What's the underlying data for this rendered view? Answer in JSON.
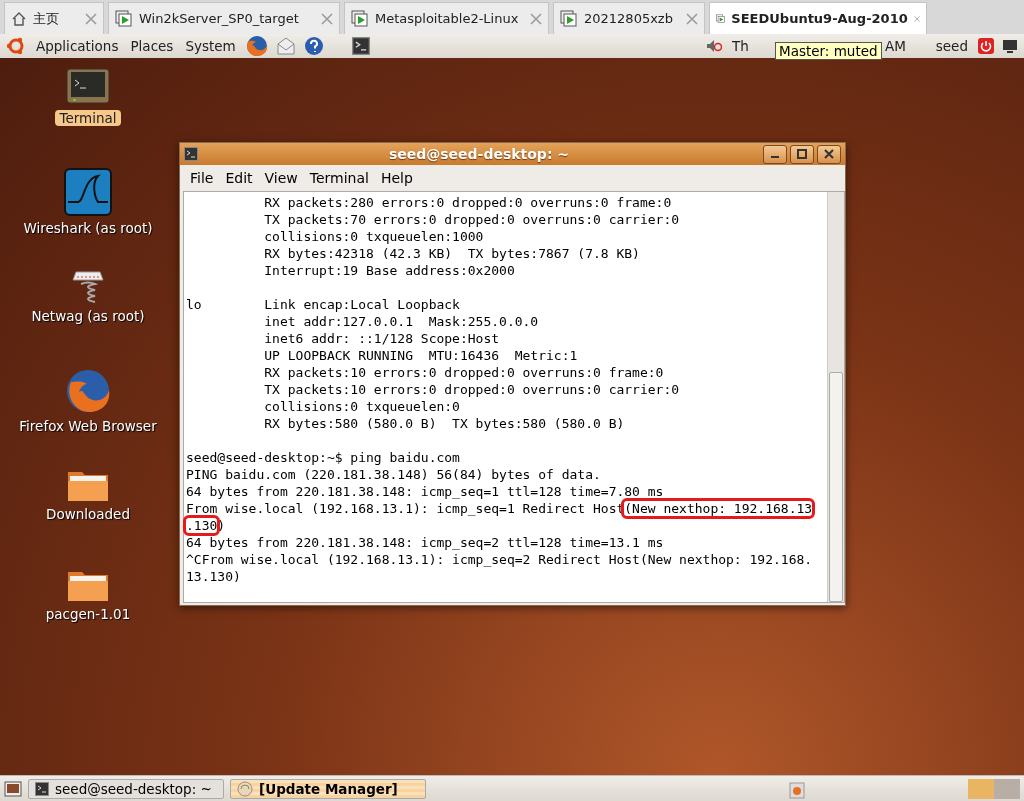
{
  "tabs": [
    {
      "label": "主页",
      "kind": "home",
      "selected": false
    },
    {
      "label": "Win2kServer_SP0_target",
      "kind": "vm",
      "selected": false
    },
    {
      "label": "Metasploitable2-Linux",
      "kind": "vm",
      "selected": false
    },
    {
      "label": "20212805xzb",
      "kind": "vm",
      "selected": false
    },
    {
      "label": "SEEDUbuntu9-Aug-2010",
      "kind": "vm",
      "selected": true
    }
  ],
  "top_panel": {
    "menus": [
      "Applications",
      "Places",
      "System"
    ],
    "clock_parts": [
      "Th",
      "AM"
    ],
    "tooltip": "Master: muted",
    "user": "seed"
  },
  "desktop_icons": [
    {
      "label": "Terminal",
      "kind": "terminal",
      "selected": true
    },
    {
      "label": "Wireshark (as root)",
      "kind": "wireshark",
      "selected": false
    },
    {
      "label": "Netwag (as root)",
      "kind": "netwag",
      "selected": false
    },
    {
      "label": "Firefox Web Browser",
      "kind": "firefox",
      "selected": false
    },
    {
      "label": "Downloaded",
      "kind": "folder",
      "selected": false
    },
    {
      "label": "pacgen-1.01",
      "kind": "folder",
      "selected": false
    }
  ],
  "window": {
    "title": "seed@seed-desktop: ~",
    "menu": [
      "File",
      "Edit",
      "View",
      "Terminal",
      "Help"
    ],
    "lines": [
      {
        "kind": "text",
        "parts": [
          {
            "text": "          RX packets:280 errors:0 dropped:0 overruns:0 frame:0",
            "boxed": false
          }
        ]
      },
      {
        "kind": "text",
        "parts": [
          {
            "text": "          TX packets:70 errors:0 dropped:0 overruns:0 carrier:0",
            "boxed": false
          }
        ]
      },
      {
        "kind": "text",
        "parts": [
          {
            "text": "          collisions:0 txqueuelen:1000",
            "boxed": false
          }
        ]
      },
      {
        "kind": "text",
        "parts": [
          {
            "text": "          RX bytes:42318 (42.3 KB)  TX bytes:7867 (7.8 KB)",
            "boxed": false
          }
        ]
      },
      {
        "kind": "text",
        "parts": [
          {
            "text": "          Interrupt:19 Base address:0x2000",
            "boxed": false
          }
        ]
      },
      {
        "kind": "blank"
      },
      {
        "kind": "text",
        "parts": [
          {
            "text": "lo        Link encap:Local Loopback",
            "boxed": false
          }
        ]
      },
      {
        "kind": "text",
        "parts": [
          {
            "text": "          inet addr:127.0.0.1  Mask:255.0.0.0",
            "boxed": false
          }
        ]
      },
      {
        "kind": "text",
        "parts": [
          {
            "text": "          inet6 addr: ::1/128 Scope:Host",
            "boxed": false
          }
        ]
      },
      {
        "kind": "text",
        "parts": [
          {
            "text": "          UP LOOPBACK RUNNING  MTU:16436  Metric:1",
            "boxed": false
          }
        ]
      },
      {
        "kind": "text",
        "parts": [
          {
            "text": "          RX packets:10 errors:0 dropped:0 overruns:0 frame:0",
            "boxed": false
          }
        ]
      },
      {
        "kind": "text",
        "parts": [
          {
            "text": "          TX packets:10 errors:0 dropped:0 overruns:0 carrier:0",
            "boxed": false
          }
        ]
      },
      {
        "kind": "text",
        "parts": [
          {
            "text": "          collisions:0 txqueuelen:0",
            "boxed": false
          }
        ]
      },
      {
        "kind": "text",
        "parts": [
          {
            "text": "          RX bytes:580 (580.0 B)  TX bytes:580 (580.0 B)",
            "boxed": false
          }
        ]
      },
      {
        "kind": "blank"
      },
      {
        "kind": "text",
        "parts": [
          {
            "text": "seed@seed-desktop:~$ ping baidu.com",
            "boxed": false
          }
        ]
      },
      {
        "kind": "text",
        "parts": [
          {
            "text": "PING baidu.com (220.181.38.148) 56(84) bytes of data.",
            "boxed": false
          }
        ]
      },
      {
        "kind": "text",
        "parts": [
          {
            "text": "64 bytes from 220.181.38.148: icmp_seq=1 ttl=128 time=7.80 ms",
            "boxed": false
          }
        ]
      },
      {
        "kind": "text",
        "parts": [
          {
            "text": "From wise.local (192.168.13.1): icmp_seq=1 Redirect Host",
            "boxed": false
          },
          {
            "text": "(New nexthop: 192.168.13",
            "boxed": true
          }
        ]
      },
      {
        "kind": "text",
        "parts": [
          {
            "text": ".130",
            "boxed": true
          },
          {
            "text": ")",
            "boxed": false
          }
        ]
      },
      {
        "kind": "text",
        "parts": [
          {
            "text": "64 bytes from 220.181.38.148: icmp_seq=2 ttl=128 time=13.1 ms",
            "boxed": false
          }
        ]
      },
      {
        "kind": "text",
        "parts": [
          {
            "text": "^CFrom wise.local (192.168.13.1): icmp_seq=2 Redirect Host(New nexthop: 192.168.",
            "boxed": false
          }
        ]
      },
      {
        "kind": "text",
        "parts": [
          {
            "text": "13.130)",
            "boxed": false
          }
        ]
      }
    ]
  },
  "bottom_panel": {
    "tasks": [
      {
        "label": "seed@seed-desktop: ~",
        "kind": "terminal",
        "attention": false
      },
      {
        "label": "[Update Manager]",
        "kind": "update",
        "attention": true
      }
    ],
    "workspaces": [
      {
        "selected": true
      },
      {
        "selected": false
      }
    ]
  }
}
